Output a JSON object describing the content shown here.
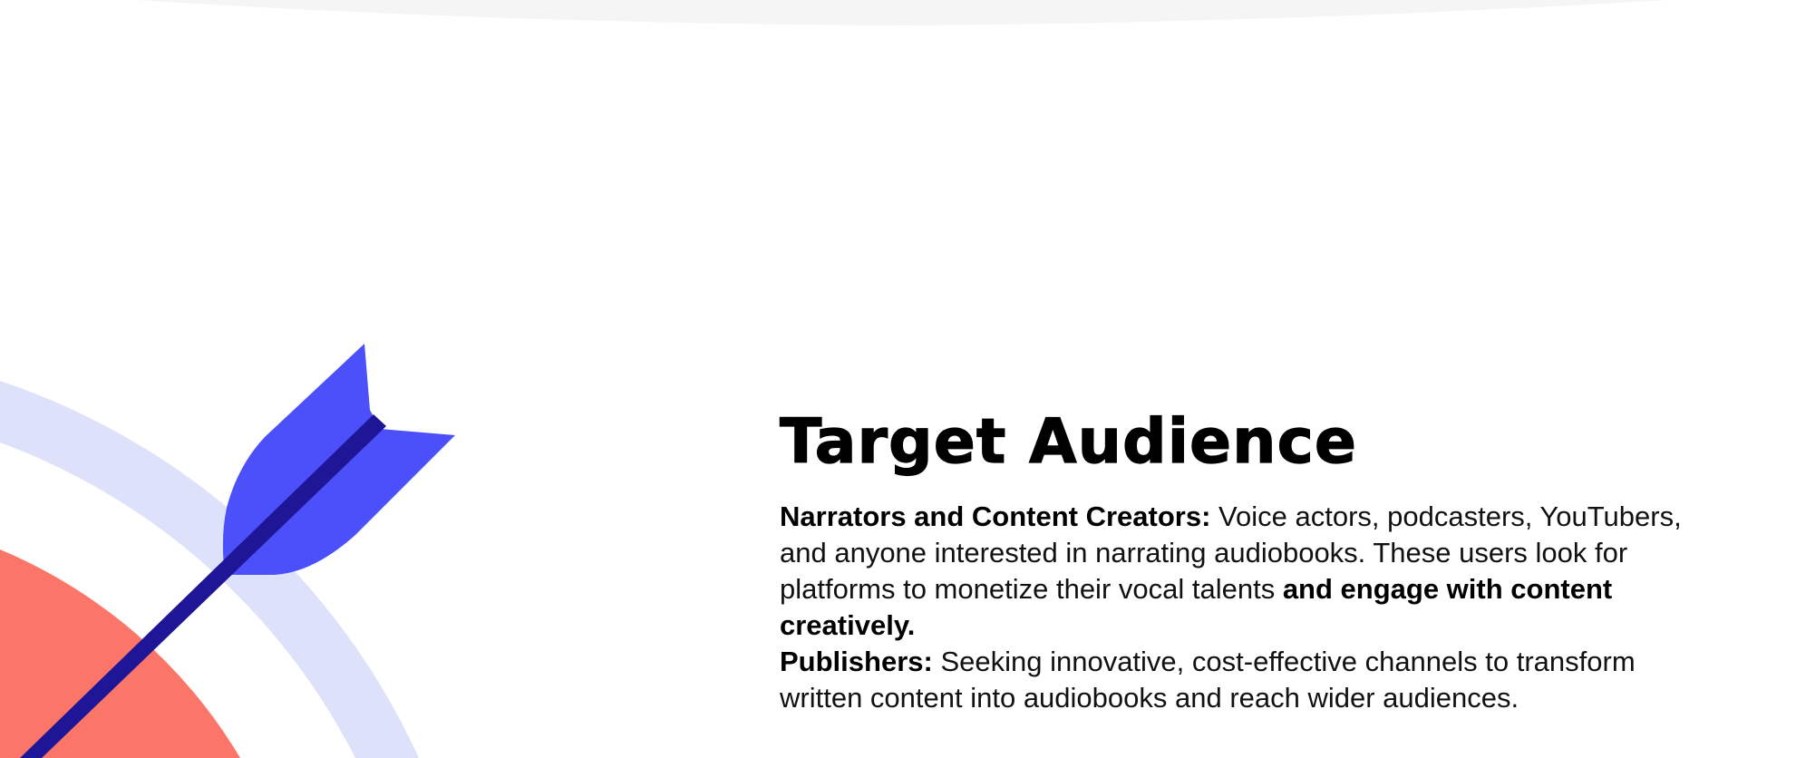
{
  "section": {
    "title": "Target Audience",
    "narrators": {
      "heading": "Narrators and Content Creators:",
      "text": " Voice actors, podcasters, YouTubers, and anyone interested in narrating audiobooks. These users look for platforms to monetize their vocal talents ",
      "emphasis": "and engage with content creatively."
    },
    "publishers": {
      "heading": "Publishers:",
      "text": " Seeking innovative, cost-effective channels to transform written content into audiobooks and reach wider audiences."
    }
  },
  "illustration": {
    "icon": "target-arrow-icon",
    "colors": {
      "outer_ring": "#dde2fa",
      "inner_target": "#fb7668",
      "arrow_shaft": "#1f1697",
      "arrow_fletching": "#4b50fa",
      "top_band": "#f5f5f5"
    }
  }
}
